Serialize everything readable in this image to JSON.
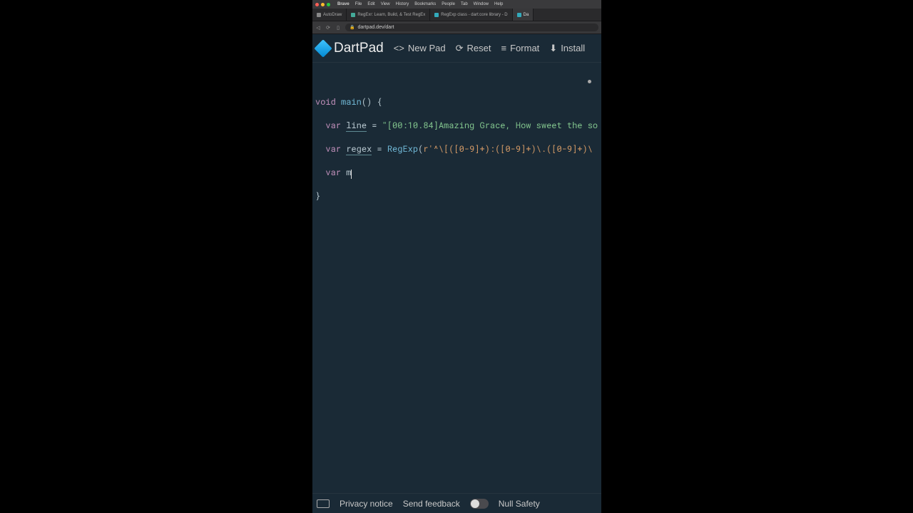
{
  "menubar": {
    "app": "Brave",
    "items": [
      "File",
      "Edit",
      "View",
      "History",
      "Bookmarks",
      "People",
      "Tab",
      "Window",
      "Help"
    ]
  },
  "tabs": [
    {
      "label": "AutoDraw",
      "favclass": "autodraw"
    },
    {
      "label": "RegExr: Learn, Build, & Test RegEx",
      "favclass": "regexr"
    },
    {
      "label": "RegExp class - dart:core library - D",
      "favclass": "dart"
    },
    {
      "label": "Da",
      "favclass": "dart"
    }
  ],
  "url": "dartpad.dev/dart",
  "toolbar": {
    "title": "DartPad",
    "newpad": "New Pad",
    "reset": "Reset",
    "format": "Format",
    "install": "Install"
  },
  "code": {
    "kw_void": "void",
    "fn_main": "main",
    "sig_open": "() {",
    "kw_var": "var",
    "id_line": "line",
    "eq": " = ",
    "str_line": "\"[00:10.84]Amazing Grace, How sweet the so",
    "id_regex": "regex",
    "cls_regexp": "RegExp",
    "paren_open": "(",
    "rprefix": "r",
    "rstr": "'^\\[([0-9]+):([0-9]+)\\.([0-9]+)\\",
    "id_m": "m",
    "brace_close": "}"
  },
  "bottom": {
    "privacy": "Privacy notice",
    "feedback": "Send feedback",
    "nullsafety": "Null Safety"
  }
}
